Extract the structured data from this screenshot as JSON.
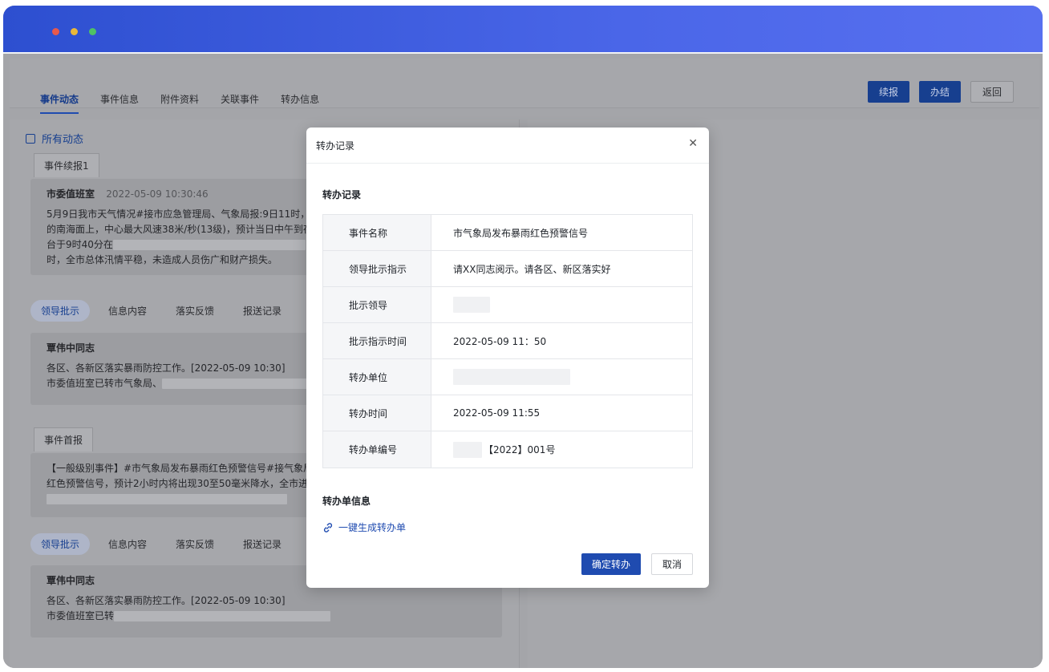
{
  "topbar": {
    "tabs": [
      "事件动态",
      "事件信息",
      "附件资料",
      "关联事件",
      "转办信息"
    ],
    "buttons": {
      "report": "续报",
      "finish": "办结",
      "back": "返回"
    }
  },
  "left": {
    "section_title": "所有动态",
    "chip1": "事件续报1",
    "card1": {
      "author": "市委值班室",
      "time": "2022-05-09 10:30:46",
      "line1": "5月9日我市天气情况#接市应急管理局、气象局报:9日11时，台风",
      "line2": "的南海面上，中心最大风速38米/秒(13级)，预计当日中午到夜间",
      "line3": "台于9时40分在",
      "line4": "时，全市总体汛情平稳，未造成人员伤广和财产损失。"
    },
    "subtabs": [
      "领导批示",
      "信息内容",
      "落实反馈",
      "报送记录"
    ],
    "card2": {
      "name": "覃伟中同志",
      "line1": "各区、各新区落实暴雨防控工作。[2022-05-09 10:30]",
      "line2": "市委值班室已转市气象局、"
    },
    "chip2": "事件首报",
    "card3": {
      "line1": "【一般级别事件】#市气象局发布暴雨红色预警信号#接气象局报:",
      "line2": "红色预警信号，预计2小时内将出现30至50毫米降水，全市进入暴"
    },
    "card4": {
      "name": "覃伟中同志",
      "line1": "各区、各新区落实暴雨防控工作。[2022-05-09 10:30]",
      "line2": "市委值班室已转"
    }
  },
  "modal": {
    "title": "转办记录",
    "section1": "转办记录",
    "rows": [
      {
        "label": "事件名称",
        "value": "市气象局发布暴雨红色预警信号"
      },
      {
        "label": "领导批示指示",
        "value": "请XX同志阅示。请各区、新区落实好"
      },
      {
        "label": "批示领导",
        "value": ""
      },
      {
        "label": "批示指示时间",
        "value": "2022-05-09  11：50"
      },
      {
        "label": "转办单位",
        "value": ""
      },
      {
        "label": "转办时间",
        "value": "2022-05-09  11:55"
      },
      {
        "label": "转办单编号",
        "value": "【2022】001号"
      }
    ],
    "section2": "转办单信息",
    "gen_link": "一键生成转办单",
    "confirm": "确定转办",
    "cancel": "取消"
  }
}
